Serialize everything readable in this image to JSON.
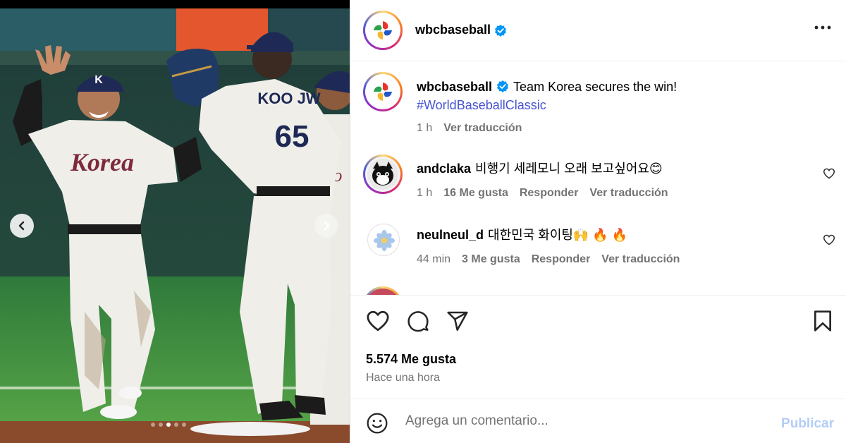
{
  "post": {
    "author": "wbcbaseball",
    "caption": "Team Korea secures the win!",
    "hashtag": "#WorldBaseballClassic",
    "caption_age": "1 h",
    "caption_translate": "Ver traducción",
    "photo": {
      "jersey_name": "KOO JW",
      "jersey_number": "65",
      "chest_text": "Korea",
      "cap_letter": "K",
      "carousel_count": 5,
      "carousel_active": 3
    }
  },
  "comments": [
    {
      "username": "andclaka",
      "text": "비행기 세레모니 오래 보고싶어요😊",
      "age": "1 h",
      "likes": "16 Me gusta",
      "reply": "Responder",
      "translate": "Ver traducción"
    },
    {
      "username": "neulneul_d",
      "text": "대한민국 화이팅🙌 🔥 🔥",
      "age": "44 min",
      "likes": "3 Me gusta",
      "reply": "Responder",
      "translate": "Ver traducción"
    }
  ],
  "footer": {
    "likes": "5.574 Me gusta",
    "time": "Hace una hora",
    "comment_placeholder": "Agrega un comentario...",
    "publish_label": "Publicar"
  },
  "colors": {
    "verified": "#0095f6",
    "hashtag": "#4553d0",
    "publish_disabled": "#b3cdf7"
  }
}
